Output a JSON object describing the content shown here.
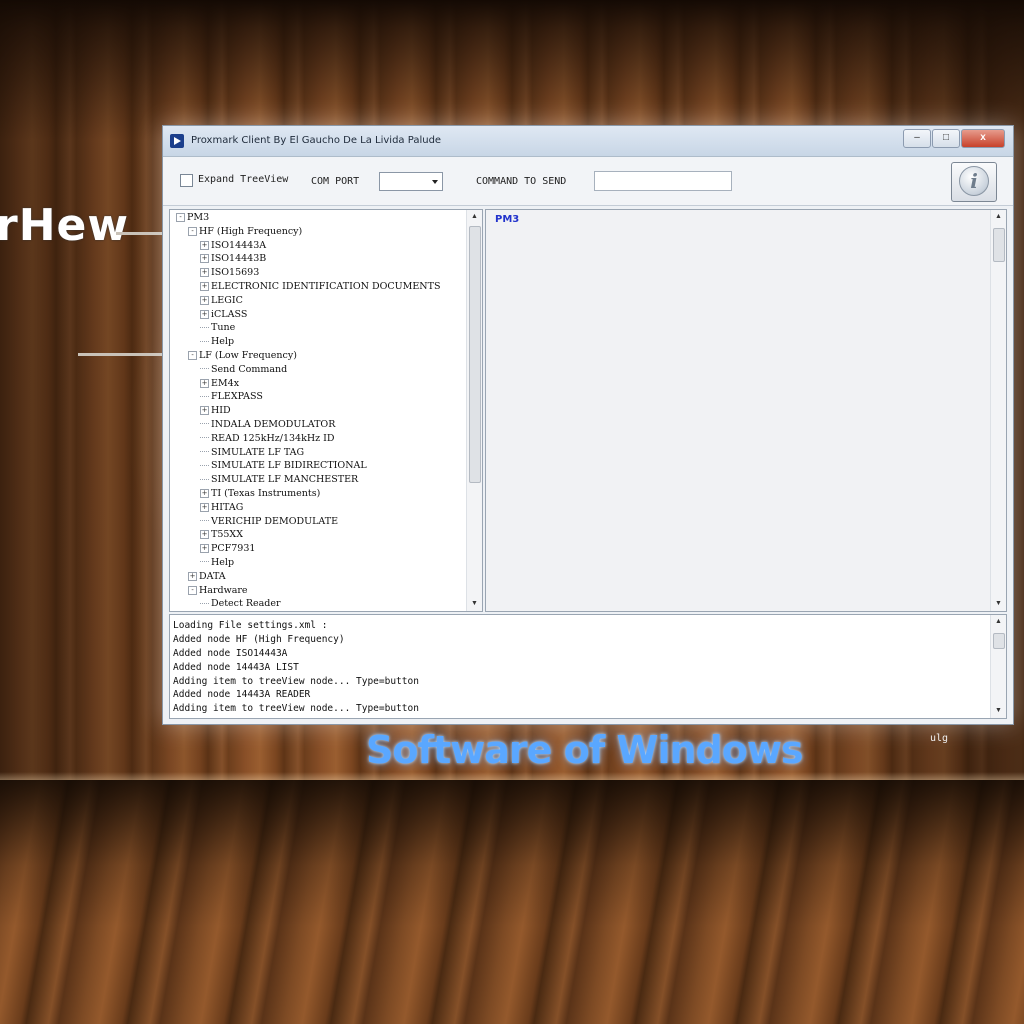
{
  "window": {
    "title": "Proxmark Client By El Gaucho De La Livida Palude",
    "controls": {
      "minimize": "–",
      "maximize": "□",
      "close": "x"
    }
  },
  "toolbar": {
    "expand_label": "Expand TreeView",
    "expand_checked": false,
    "com_port_label": "COM PORT",
    "com_port_value": "",
    "command_label": "COMMAND TO SEND",
    "command_value": "",
    "info_glyph": "i"
  },
  "tree": {
    "rows": [
      {
        "label": "PM3",
        "level": 0,
        "toggle": "-"
      },
      {
        "label": "HF (High Frequency)",
        "level": 1,
        "toggle": "-"
      },
      {
        "label": "ISO14443A",
        "level": 2,
        "toggle": "+"
      },
      {
        "label": "ISO14443B",
        "level": 2,
        "toggle": "+"
      },
      {
        "label": "ISO15693",
        "level": 2,
        "toggle": "+"
      },
      {
        "label": "ELECTRONIC IDENTIFICATION DOCUMENTS",
        "level": 2,
        "toggle": "+"
      },
      {
        "label": "LEGIC",
        "level": 2,
        "toggle": "+"
      },
      {
        "label": "iCLASS",
        "level": 2,
        "toggle": "+"
      },
      {
        "label": "Tune",
        "level": 2,
        "toggle": ""
      },
      {
        "label": "Help",
        "level": 2,
        "toggle": ""
      },
      {
        "label": "LF (Low Frequency)",
        "level": 1,
        "toggle": "-"
      },
      {
        "label": "Send Command",
        "level": 2,
        "toggle": ""
      },
      {
        "label": "EM4x",
        "level": 2,
        "toggle": "+"
      },
      {
        "label": "FLEXPASS",
        "level": 2,
        "toggle": ""
      },
      {
        "label": "HID",
        "level": 2,
        "toggle": "+"
      },
      {
        "label": "INDALA DEMODULATOR",
        "level": 2,
        "toggle": ""
      },
      {
        "label": "READ 125kHz/134kHz ID",
        "level": 2,
        "toggle": ""
      },
      {
        "label": "SIMULATE LF TAG",
        "level": 2,
        "toggle": ""
      },
      {
        "label": "SIMULATE LF BIDIRECTIONAL",
        "level": 2,
        "toggle": ""
      },
      {
        "label": "SIMULATE LF MANCHESTER",
        "level": 2,
        "toggle": ""
      },
      {
        "label": "TI (Texas Instruments)",
        "level": 2,
        "toggle": "+"
      },
      {
        "label": "HITAG",
        "level": 2,
        "toggle": "+"
      },
      {
        "label": "VERICHIP DEMODULATE",
        "level": 2,
        "toggle": ""
      },
      {
        "label": "T55XX",
        "level": 2,
        "toggle": "+"
      },
      {
        "label": "PCF7931",
        "level": 2,
        "toggle": "+"
      },
      {
        "label": "Help",
        "level": 2,
        "toggle": ""
      },
      {
        "label": "DATA",
        "level": 1,
        "toggle": "+"
      },
      {
        "label": "Hardware",
        "level": 1,
        "toggle": "-"
      },
      {
        "label": "Detect Reader",
        "level": 2,
        "toggle": ""
      }
    ]
  },
  "output": {
    "title": "PM3"
  },
  "log": {
    "lines": [
      "Loading File settings.xml :",
      "Added node HF (High Frequency)",
      "Added node ISO14443A",
      "Added node 14443A LIST",
      "Adding item to treeView node... Type=button",
      "Added node 14443A READER",
      "Adding item to treeView node... Type=button"
    ]
  },
  "overlay": {
    "left_text": "rHew",
    "caption": "Software of Windows",
    "corner_mark": "ulg",
    "arrow_color": "#f0a030",
    "caption_color": "#5aa7ff"
  }
}
